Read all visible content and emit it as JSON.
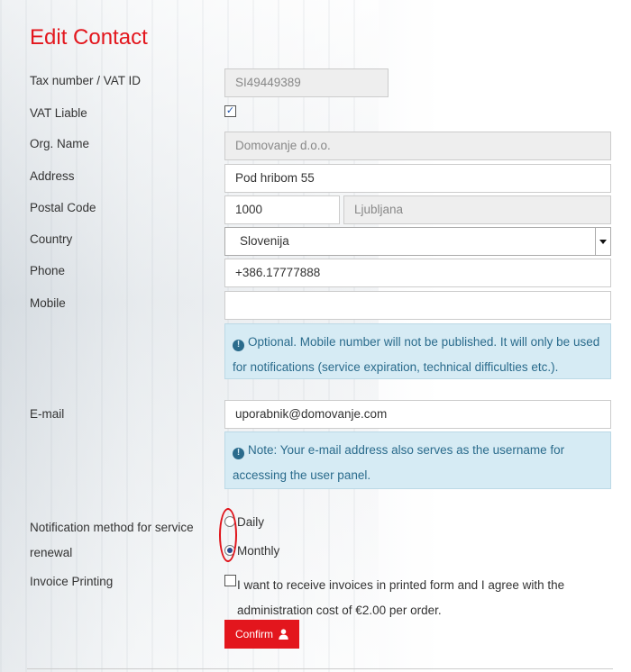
{
  "page": {
    "title": "Edit Contact"
  },
  "form": {
    "tax": {
      "label": "Tax number / VAT ID",
      "value": "SI49449389"
    },
    "vat_liable": {
      "label": "VAT Liable",
      "checked": true,
      "check_glyph": "✓"
    },
    "org_name": {
      "label": "Org. Name",
      "value": "Domovanje d.o.o."
    },
    "address": {
      "label": "Address",
      "value": "Pod hribom 55"
    },
    "postal": {
      "label": "Postal Code",
      "code": "1000",
      "city": "Ljubljana"
    },
    "country": {
      "label": "Country",
      "selected": "Slovenija"
    },
    "phone": {
      "label": "Phone",
      "value": "+386.17777888"
    },
    "mobile": {
      "label": "Mobile",
      "value": "",
      "info": "Optional. Mobile number will not be published. It will only be used for notifications (service expiration, technical difficulties etc.)."
    },
    "email": {
      "label": "E-mail",
      "value": "uporabnik@domovanje.com",
      "info": "Note: Your e-mail address also serves as the username for accessing the user panel."
    },
    "notification": {
      "label": "Notification method for service renewal",
      "options": [
        {
          "label": "Daily",
          "checked": false
        },
        {
          "label": "Monthly",
          "checked": true
        }
      ]
    },
    "invoice": {
      "label": "Invoice Printing",
      "checked": false,
      "text": "I want to receive invoices in printed form and I agree with the administration cost of €2.00 per order."
    },
    "confirm_label": "Confirm"
  },
  "icons": {
    "info": "info-circle-icon",
    "user": "user-icon",
    "select_arrow": "chevron-down-icon"
  },
  "colors": {
    "accent": "#e3161d",
    "info_bg": "#d6ebf4",
    "info_text": "#2a6b8c",
    "annotation": "#e0141b"
  }
}
